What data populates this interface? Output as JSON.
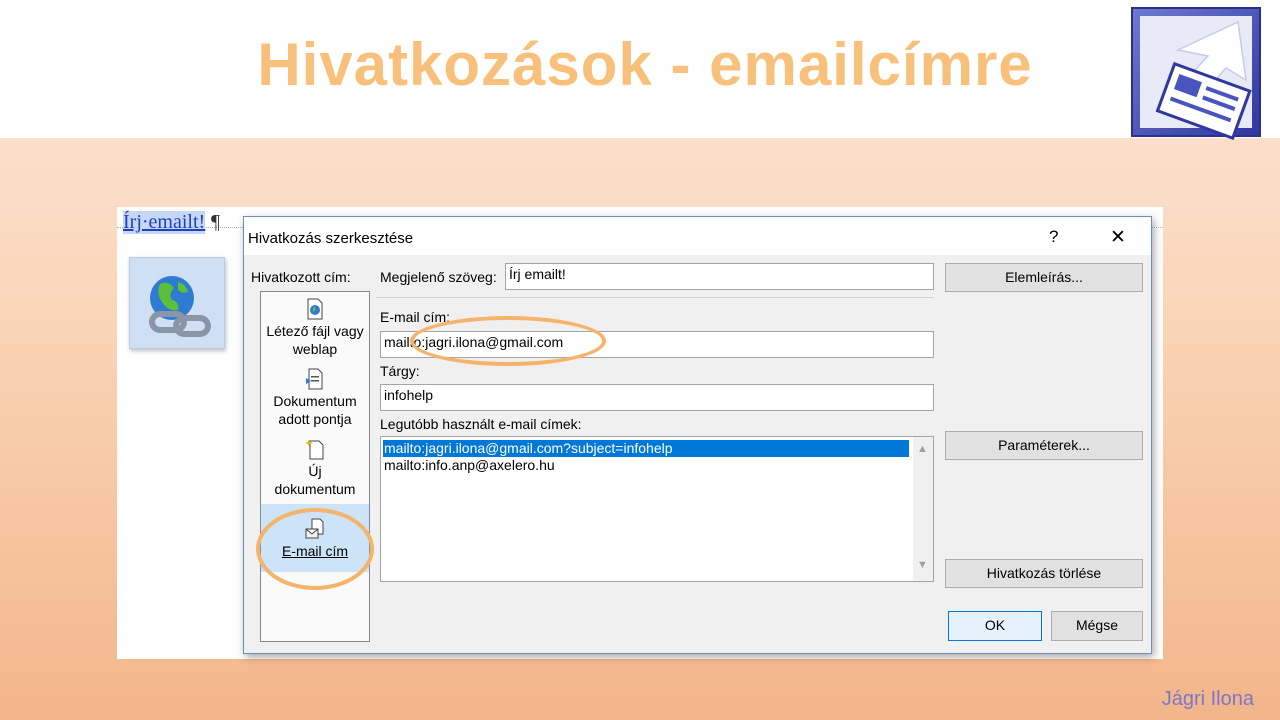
{
  "slide": {
    "title": "Hivatkozások - emailcímre",
    "author": "Jágri Ilona"
  },
  "document": {
    "link_text": "Írj·emailt!",
    "pilcrow": "¶"
  },
  "dialog": {
    "title": "Hivatkozás szerkesztése",
    "help": "?",
    "close": "✕",
    "link_to_label": "Hivatkozott cím:",
    "sidebar": [
      {
        "line1": "Létező fájl vagy",
        "line2": "weblap"
      },
      {
        "line1": "Dokumentum",
        "line2": "adott pontja"
      },
      {
        "line1": "Új",
        "line2": "dokumentum"
      },
      {
        "line1": "E-mail cím",
        "line2": ""
      }
    ],
    "display_text_label": "Megjelenő szöveg:",
    "display_text_value": "Írj emailt!",
    "screentip_button": "Elemleírás...",
    "email_label": "E-mail cím:",
    "email_value": "mailto:jagri.ilona@gmail.com",
    "subject_label": "Tárgy:",
    "subject_value": "infohelp",
    "recent_label": "Legutóbb használt e-mail címek:",
    "recent_items": [
      "mailto:jagri.ilona@gmail.com?subject=infohelp",
      "mailto:info.anp@axelero.hu"
    ],
    "parameters_button": "Paraméterek...",
    "remove_link_button": "Hivatkozás törlése",
    "ok_button": "OK",
    "cancel_button": "Mégse"
  },
  "colors": {
    "title": "#f8c07a",
    "highlight_ellipse": "#f5b36b",
    "selection": "#0078d7",
    "author": "#7b76c8"
  }
}
